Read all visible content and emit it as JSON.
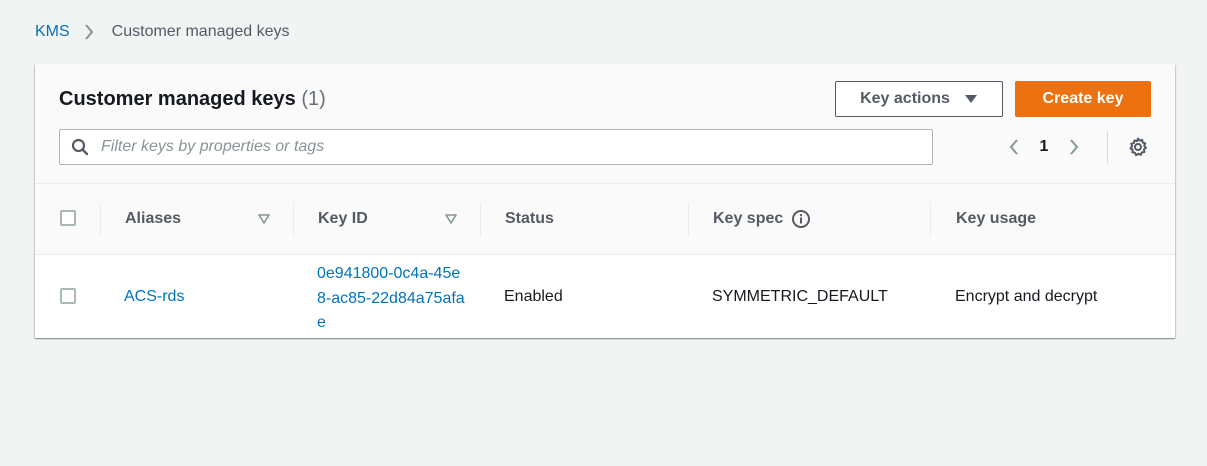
{
  "breadcrumb": {
    "root": "KMS",
    "current": "Customer managed keys"
  },
  "panel": {
    "title": "Customer managed keys",
    "count": "(1)",
    "key_actions_label": "Key actions",
    "create_key_label": "Create key"
  },
  "search": {
    "placeholder": "Filter keys by properties or tags",
    "value": ""
  },
  "pagination": {
    "current_page": "1"
  },
  "table": {
    "columns": {
      "aliases": "Aliases",
      "key_id": "Key ID",
      "status": "Status",
      "key_spec": "Key spec",
      "key_usage": "Key usage"
    },
    "rows": [
      {
        "alias": "ACS-rds",
        "key_id": "0e941800-0c4a-45e8-ac85-22d84a75afae",
        "status": "Enabled",
        "key_spec": "SYMMETRIC_DEFAULT",
        "key_usage": "Encrypt and decrypt"
      }
    ]
  },
  "colors": {
    "background": "#f2f3f3",
    "link": "#0073bb",
    "primary_button": "#ec7211",
    "text": "#16191f",
    "muted_text": "#545b64"
  },
  "icons": {
    "breadcrumb_separator": "chevron-right-icon",
    "key_actions": "caret-down-icon",
    "search": "search-icon",
    "prev_page": "chevron-left-icon",
    "next_page": "chevron-right-icon",
    "settings": "gear-icon",
    "sort": "sort-down-icon",
    "info": "info-icon"
  }
}
